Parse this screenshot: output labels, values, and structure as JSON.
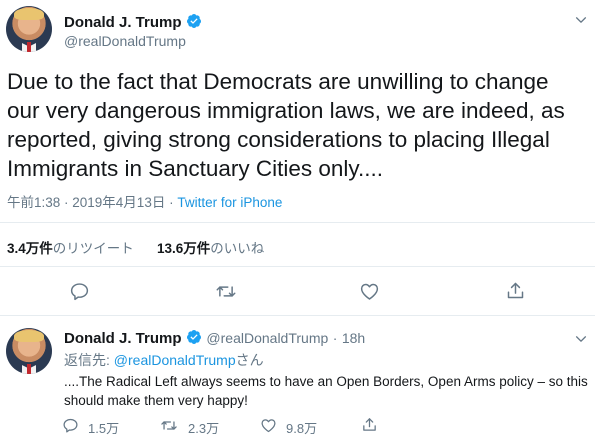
{
  "main_tweet": {
    "author_name": "Donald J. Trump",
    "author_handle": "@realDonaldTrump",
    "text": "Due to the fact that Democrats are unwilling to change our very dangerous immigration laws, we are indeed, as reported, giving strong considerations to placing Illegal Immigrants in Sanctuary Cities only....",
    "timestamp": "午前1:38 · 2019年4月13日",
    "source": "Twitter for iPhone",
    "retweets_count": "3.4万件",
    "retweets_label": "のリツイート",
    "likes_count": "13.6万件",
    "likes_label": "のいいね"
  },
  "reply_tweet": {
    "author_name": "Donald J. Trump",
    "author_handle": "@realDonaldTrump",
    "separator": "·",
    "time_ago": "18h",
    "reply_prefix": "返信先:",
    "reply_mention": "@realDonaldTrump",
    "reply_suffix": "さん",
    "text": "....The Radical Left always seems to have an Open Borders, Open Arms policy – so this should make them very happy!",
    "reply_count": "1.5万",
    "retweet_count": "2.3万",
    "like_count": "9.8万"
  },
  "icons": {
    "verified": "verified-badge-icon",
    "chevron": "chevron-down-icon",
    "reply": "reply-icon",
    "retweet": "retweet-icon",
    "like": "heart-icon",
    "share": "share-icon"
  },
  "colors": {
    "text": "#14171a",
    "secondary": "#657786",
    "link": "#1b95e0",
    "verified": "#1da1f2",
    "divider": "#e6ecf0"
  }
}
